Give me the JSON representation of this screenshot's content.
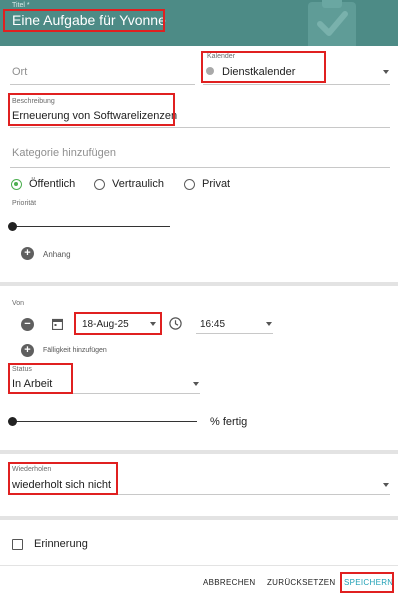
{
  "header": {
    "title_label": "Titel *",
    "title_value": "Eine Aufgabe für Yvonne"
  },
  "calendar": {
    "label": "Kalender",
    "value": "Dienstkalender"
  },
  "location": {
    "placeholder": "Ort"
  },
  "description": {
    "label": "Beschreibung",
    "value": "Erneuerung von Softwarelizenzen"
  },
  "category": {
    "placeholder": "Kategorie hinzufügen"
  },
  "visibility": {
    "options": [
      "Öffentlich",
      "Vertraulich",
      "Privat"
    ],
    "selected": "Öffentlich"
  },
  "priority": {
    "label": "Priorität",
    "level": 0
  },
  "attachment": {
    "label": "Anhang"
  },
  "from": {
    "label": "Von",
    "date": "18-Aug-25",
    "time": "16:45"
  },
  "due": {
    "label": "Fälligkeit hinzufügen"
  },
  "status": {
    "label": "Status",
    "value": "In Arbeit"
  },
  "progress": {
    "suffix": "% fertig",
    "percent": 0
  },
  "repeat": {
    "label": "Wiederholen",
    "value": "wiederholt sich nicht"
  },
  "reminder": {
    "label": "Erinnerung",
    "checked": false
  },
  "actions": {
    "cancel": "ABBRECHEN",
    "reset": "ZURÜCKSETZEN",
    "save": "SPEICHERN"
  },
  "colors": {
    "header": "#4d8b86",
    "accent": "#1e9fb5",
    "radio_on": "#4caf50",
    "highlight": "#e02020"
  },
  "icons": [
    "checklist-icon",
    "calendar-icon",
    "clock-icon",
    "plus-icon",
    "minus-icon",
    "chevron-down-icon"
  ]
}
